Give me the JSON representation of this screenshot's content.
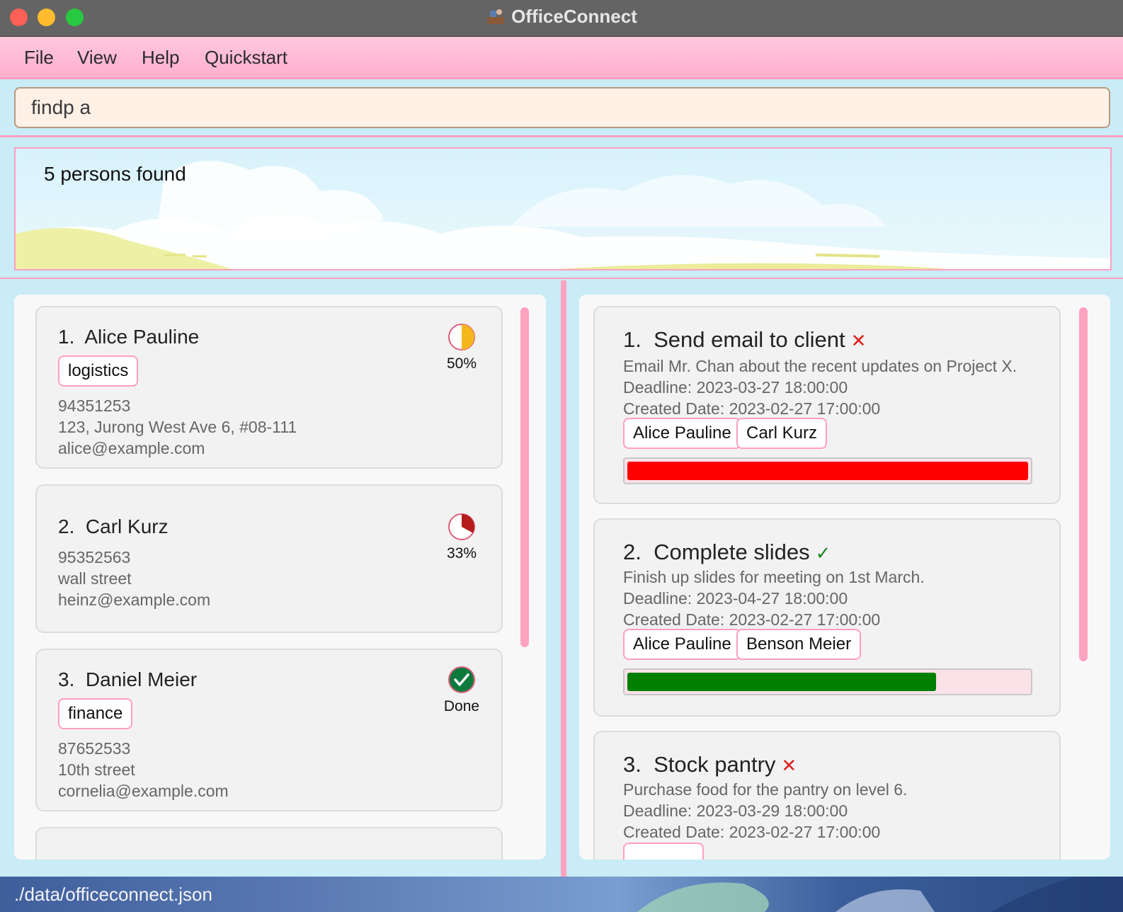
{
  "window": {
    "title": "OfficeConnect"
  },
  "menu": {
    "items": [
      "File",
      "View",
      "Help",
      "Quickstart"
    ]
  },
  "command": {
    "value": "findp a"
  },
  "result": {
    "message": "5 persons found"
  },
  "persons": [
    {
      "index": "1.",
      "name": "Alice Pauline",
      "tags": [
        "logistics"
      ],
      "phone": "94351253",
      "address": "123, Jurong West Ave 6, #08-111",
      "email": "alice@example.com",
      "progress_label": "50%",
      "progress": 0.5,
      "progress_color": "#f3b71b"
    },
    {
      "index": "2.",
      "name": "Carl Kurz",
      "tags": [],
      "phone": "95352563",
      "address": "wall street",
      "email": "heinz@example.com",
      "progress_label": "33%",
      "progress": 0.33,
      "progress_color": "#b51d1d"
    },
    {
      "index": "3.",
      "name": "Daniel Meier",
      "tags": [
        "finance"
      ],
      "phone": "87652533",
      "address": "10th street",
      "email": "cornelia@example.com",
      "progress_label": "Done",
      "progress": 1,
      "progress_color": "#0d7a3c"
    }
  ],
  "tasks": [
    {
      "index": "1.",
      "title": "Send email to client",
      "status_icon": "cross-icon",
      "description": "Email Mr. Chan about the recent updates on Project X.",
      "deadline": "Deadline: 2023-03-27 18:00:00",
      "created": "Created Date: 2023-02-27 17:00:00",
      "assignees": [
        "Alice Pauline",
        "Carl Kurz"
      ],
      "bar_fraction": 1,
      "bar_color": "#ff0000"
    },
    {
      "index": "2.",
      "title": "Complete slides",
      "status_icon": "check-icon",
      "description": "Finish up slides for meeting on 1st March.",
      "deadline": "Deadline: 2023-04-27 18:00:00",
      "created": "Created Date: 2023-02-27 17:00:00",
      "assignees": [
        "Alice Pauline",
        "Benson Meier"
      ],
      "bar_fraction": 0.77,
      "bar_color": "#008000"
    },
    {
      "index": "3.",
      "title": "Stock pantry",
      "status_icon": "cross-icon",
      "description": "Purchase food for the pantry on level 6.",
      "deadline": "Deadline: 2023-03-29 18:00:00",
      "created": "Created Date: 2023-02-27 17:00:00",
      "assignees": []
    }
  ],
  "status_bar": {
    "path": "./data/officeconnect.json"
  },
  "colors": {
    "accent": "#ff9ec2",
    "menu_bg": "#ffc7dd",
    "background": "#c9ecf6"
  }
}
